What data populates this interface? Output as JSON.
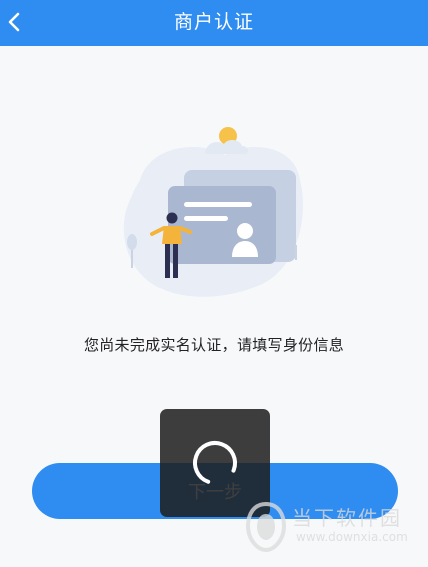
{
  "header": {
    "title": "商户认证",
    "back_icon": "chevron-left-icon",
    "background": "#2f8cf0"
  },
  "illustration": {
    "description_icon": "id-card-illustration"
  },
  "main": {
    "message": "您尚未完成实名认证，请填写身份信息"
  },
  "actions": {
    "next_label": "下一步",
    "accent": "#2f8cf0"
  },
  "loading": {
    "icon": "spinner-icon",
    "visible": true
  },
  "watermark": {
    "text": "当下软件园",
    "url": "www.downxia.com"
  }
}
